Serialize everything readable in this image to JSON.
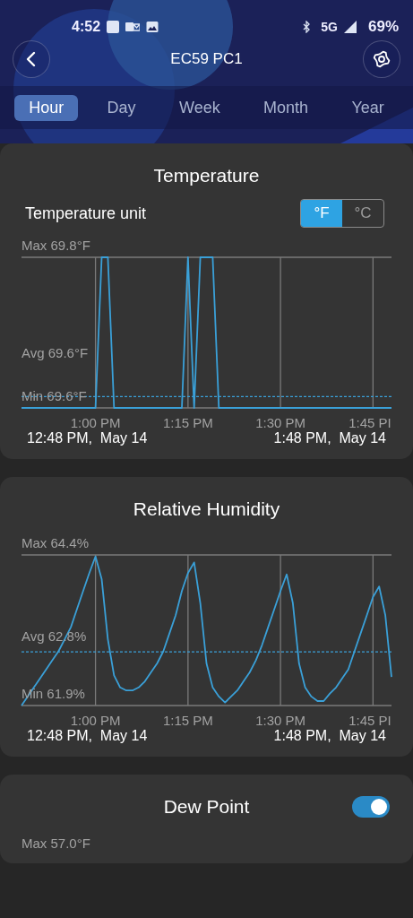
{
  "status_bar": {
    "time": "4:52",
    "network": "5G",
    "battery": "69%"
  },
  "header": {
    "title": "EC59 PC1"
  },
  "tabs": [
    {
      "label": "Hour",
      "selected": true
    },
    {
      "label": "Day",
      "selected": false
    },
    {
      "label": "Week",
      "selected": false
    },
    {
      "label": "Month",
      "selected": false
    },
    {
      "label": "Year",
      "selected": false
    }
  ],
  "cards": [
    {
      "kind": "chart",
      "title": "Temperature",
      "unit_label": "Temperature unit",
      "units": [
        {
          "label": "°F",
          "selected": true
        },
        {
          "label": "°C",
          "selected": false
        }
      ],
      "chart": {
        "max_label": "Max 69.8°F",
        "avg_label": "Avg 69.6°F",
        "min_label": "Min 69.6°F",
        "x_labels": [
          "1:00 PM",
          "1:15 PM",
          "1:30 PM",
          "1:45 PI"
        ]
      },
      "range_start": "12:48 PM,  May 14",
      "range_end": "1:48 PM,  May 14"
    },
    {
      "kind": "chart",
      "title": "Relative Humidity",
      "chart": {
        "max_label": "Max 64.4%",
        "avg_label": "Avg 62.8%",
        "min_label": "Min 61.9%",
        "x_labels": [
          "1:00 PM",
          "1:15 PM",
          "1:30 PM",
          "1:45 PI"
        ]
      },
      "range_start": "12:48 PM,  May 14",
      "range_end": "1:48 PM,  May 14"
    },
    {
      "kind": "toggle",
      "title": "Dew Point",
      "on": true,
      "max_label": "Max 57.0°F"
    }
  ]
}
